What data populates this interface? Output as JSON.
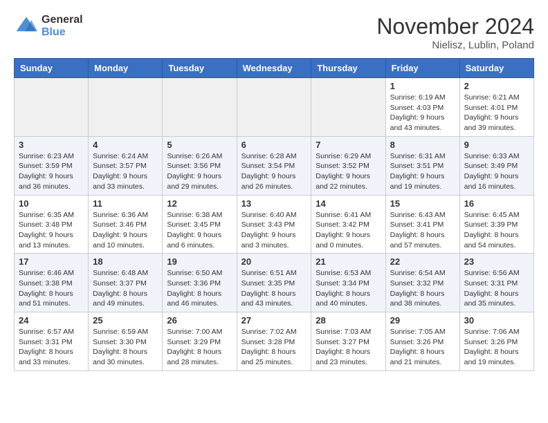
{
  "header": {
    "logo": {
      "general": "General",
      "blue": "Blue"
    },
    "title": "November 2024",
    "location": "Nielisz, Lublin, Poland"
  },
  "weekdays": [
    "Sunday",
    "Monday",
    "Tuesday",
    "Wednesday",
    "Thursday",
    "Friday",
    "Saturday"
  ],
  "weeks": [
    [
      {
        "day": "",
        "info": ""
      },
      {
        "day": "",
        "info": ""
      },
      {
        "day": "",
        "info": ""
      },
      {
        "day": "",
        "info": ""
      },
      {
        "day": "",
        "info": ""
      },
      {
        "day": "1",
        "info": "Sunrise: 6:19 AM\nSunset: 4:03 PM\nDaylight: 9 hours and 43 minutes."
      },
      {
        "day": "2",
        "info": "Sunrise: 6:21 AM\nSunset: 4:01 PM\nDaylight: 9 hours and 39 minutes."
      }
    ],
    [
      {
        "day": "3",
        "info": "Sunrise: 6:23 AM\nSunset: 3:59 PM\nDaylight: 9 hours and 36 minutes."
      },
      {
        "day": "4",
        "info": "Sunrise: 6:24 AM\nSunset: 3:57 PM\nDaylight: 9 hours and 33 minutes."
      },
      {
        "day": "5",
        "info": "Sunrise: 6:26 AM\nSunset: 3:56 PM\nDaylight: 9 hours and 29 minutes."
      },
      {
        "day": "6",
        "info": "Sunrise: 6:28 AM\nSunset: 3:54 PM\nDaylight: 9 hours and 26 minutes."
      },
      {
        "day": "7",
        "info": "Sunrise: 6:29 AM\nSunset: 3:52 PM\nDaylight: 9 hours and 22 minutes."
      },
      {
        "day": "8",
        "info": "Sunrise: 6:31 AM\nSunset: 3:51 PM\nDaylight: 9 hours and 19 minutes."
      },
      {
        "day": "9",
        "info": "Sunrise: 6:33 AM\nSunset: 3:49 PM\nDaylight: 9 hours and 16 minutes."
      }
    ],
    [
      {
        "day": "10",
        "info": "Sunrise: 6:35 AM\nSunset: 3:48 PM\nDaylight: 9 hours and 13 minutes."
      },
      {
        "day": "11",
        "info": "Sunrise: 6:36 AM\nSunset: 3:46 PM\nDaylight: 9 hours and 10 minutes."
      },
      {
        "day": "12",
        "info": "Sunrise: 6:38 AM\nSunset: 3:45 PM\nDaylight: 9 hours and 6 minutes."
      },
      {
        "day": "13",
        "info": "Sunrise: 6:40 AM\nSunset: 3:43 PM\nDaylight: 9 hours and 3 minutes."
      },
      {
        "day": "14",
        "info": "Sunrise: 6:41 AM\nSunset: 3:42 PM\nDaylight: 9 hours and 0 minutes."
      },
      {
        "day": "15",
        "info": "Sunrise: 6:43 AM\nSunset: 3:41 PM\nDaylight: 8 hours and 57 minutes."
      },
      {
        "day": "16",
        "info": "Sunrise: 6:45 AM\nSunset: 3:39 PM\nDaylight: 8 hours and 54 minutes."
      }
    ],
    [
      {
        "day": "17",
        "info": "Sunrise: 6:46 AM\nSunset: 3:38 PM\nDaylight: 8 hours and 51 minutes."
      },
      {
        "day": "18",
        "info": "Sunrise: 6:48 AM\nSunset: 3:37 PM\nDaylight: 8 hours and 49 minutes."
      },
      {
        "day": "19",
        "info": "Sunrise: 6:50 AM\nSunset: 3:36 PM\nDaylight: 8 hours and 46 minutes."
      },
      {
        "day": "20",
        "info": "Sunrise: 6:51 AM\nSunset: 3:35 PM\nDaylight: 8 hours and 43 minutes."
      },
      {
        "day": "21",
        "info": "Sunrise: 6:53 AM\nSunset: 3:34 PM\nDaylight: 8 hours and 40 minutes."
      },
      {
        "day": "22",
        "info": "Sunrise: 6:54 AM\nSunset: 3:32 PM\nDaylight: 8 hours and 38 minutes."
      },
      {
        "day": "23",
        "info": "Sunrise: 6:56 AM\nSunset: 3:31 PM\nDaylight: 8 hours and 35 minutes."
      }
    ],
    [
      {
        "day": "24",
        "info": "Sunrise: 6:57 AM\nSunset: 3:31 PM\nDaylight: 8 hours and 33 minutes."
      },
      {
        "day": "25",
        "info": "Sunrise: 6:59 AM\nSunset: 3:30 PM\nDaylight: 8 hours and 30 minutes."
      },
      {
        "day": "26",
        "info": "Sunrise: 7:00 AM\nSunset: 3:29 PM\nDaylight: 8 hours and 28 minutes."
      },
      {
        "day": "27",
        "info": "Sunrise: 7:02 AM\nSunset: 3:28 PM\nDaylight: 8 hours and 25 minutes."
      },
      {
        "day": "28",
        "info": "Sunrise: 7:03 AM\nSunset: 3:27 PM\nDaylight: 8 hours and 23 minutes."
      },
      {
        "day": "29",
        "info": "Sunrise: 7:05 AM\nSunset: 3:26 PM\nDaylight: 8 hours and 21 minutes."
      },
      {
        "day": "30",
        "info": "Sunrise: 7:06 AM\nSunset: 3:26 PM\nDaylight: 8 hours and 19 minutes."
      }
    ]
  ]
}
